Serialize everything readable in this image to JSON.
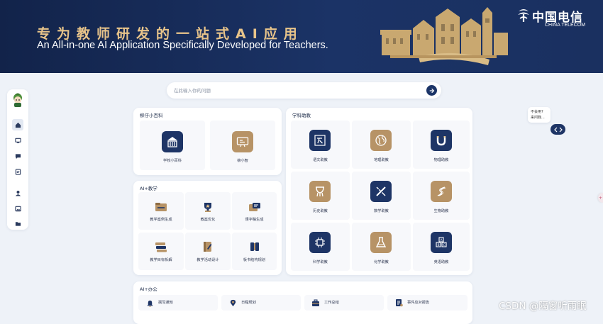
{
  "banner": {
    "title_cn": "专为教师研发的一站式AI应用",
    "title_en": "An All-in-one AI Application Specifically Developed for Teachers.",
    "brand_cn": "中国电信",
    "brand_en": "CHINA TELECOM"
  },
  "search": {
    "placeholder": "在此输入你的问题"
  },
  "encyclopedia": {
    "title": "柳仔小百科",
    "items": [
      {
        "label": "学校小百科",
        "icon": "school-building-icon"
      },
      {
        "label": "柳小智",
        "icon": "chat-screen-icon"
      }
    ]
  },
  "ai_teaching": {
    "title": "AI+教学",
    "items": [
      {
        "label": "教学案例生成",
        "icon": "case-folder-icon"
      },
      {
        "label": "教案优化",
        "icon": "trophy-icon"
      },
      {
        "label": "课字稿生成",
        "icon": "script-card-icon"
      },
      {
        "label": "教学目标拆解",
        "icon": "goal-stack-icon"
      },
      {
        "label": "教学活动设计",
        "icon": "activity-notebook-icon"
      },
      {
        "label": "板书结构规划",
        "icon": "blackboard-icon"
      }
    ]
  },
  "subjects": {
    "title": "学科助教",
    "items": [
      {
        "label": "语文助教",
        "icon": "chinese-character-icon",
        "color": "navy"
      },
      {
        "label": "地理助教",
        "icon": "globe-icon",
        "color": "tan"
      },
      {
        "label": "物理助教",
        "icon": "magnet-icon",
        "color": "navy"
      },
      {
        "label": "历史助教",
        "icon": "ancient-vessel-icon",
        "color": "tan"
      },
      {
        "label": "数学助教",
        "icon": "ruler-pencil-icon",
        "color": "navy"
      },
      {
        "label": "生物助教",
        "icon": "dna-icon",
        "color": "tan"
      },
      {
        "label": "科学助教",
        "icon": "chip-icon",
        "color": "navy"
      },
      {
        "label": "化学助教",
        "icon": "flask-icon",
        "color": "tan"
      },
      {
        "label": "英语助教",
        "icon": "abc-blocks-icon",
        "color": "navy"
      }
    ]
  },
  "office": {
    "title": "AI+办公",
    "items": [
      {
        "label": "撰写通知",
        "icon": "bell-icon"
      },
      {
        "label": "日程规划",
        "icon": "map-pin-icon"
      },
      {
        "label": "工作总结",
        "icon": "briefcase-icon"
      },
      {
        "label": "事件应对报告",
        "icon": "report-icon"
      }
    ]
  },
  "assistant": {
    "bubble_line1": "不会用?",
    "bubble_line2": "来问我..."
  },
  "watermark": "CSDN @隔窗听雨眠",
  "colors": {
    "navy": "#1e3566",
    "tan": "#b79366",
    "gold": "#e8c48a",
    "background": "#eef2f8"
  }
}
